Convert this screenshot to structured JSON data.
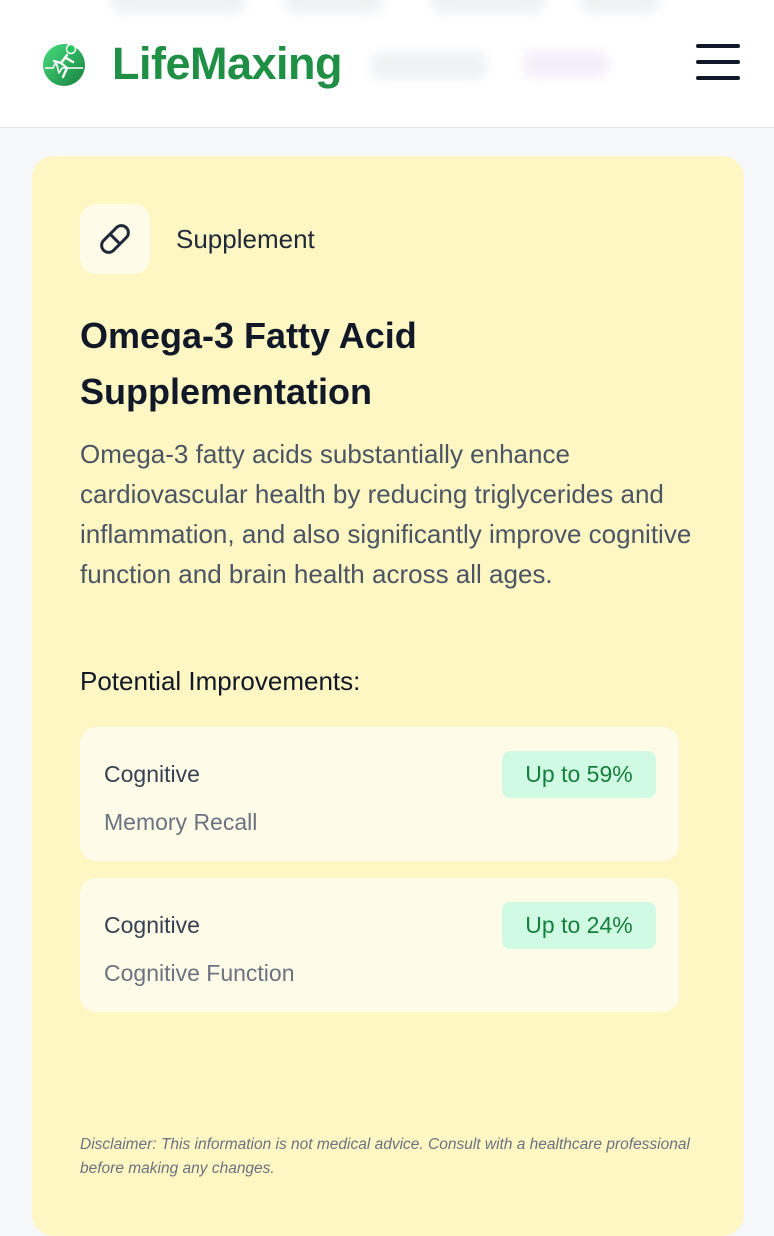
{
  "app": {
    "brand": "LifeMaxing",
    "logo_icon": "runner-heartbeat-icon",
    "brand_color": "#1f8f45",
    "menu_icon": "hamburger-menu-icon"
  },
  "card": {
    "background": "#fef7c3",
    "type_icon": "pill-icon",
    "type_label": "Supplement",
    "title": "Omega-3 Fatty Acid Supplementation",
    "description": "Omega-3 fatty acids substantially enhance cardiovascular health by reducing triglycerides and inflammation, and also significantly improve cognitive function and brain health across all ages.",
    "improvements_heading": "Potential Improvements:",
    "improvements": [
      {
        "category": "Cognitive",
        "metric": "Memory Recall",
        "badge": "Up to 59%"
      },
      {
        "category": "Cognitive",
        "metric": "Cognitive Function",
        "badge": "Up to 24%"
      }
    ],
    "badge_color": "#15803d",
    "disclaimer": "Disclaimer: This information is not medical advice. Consult with a healthcare professional before making any changes."
  }
}
